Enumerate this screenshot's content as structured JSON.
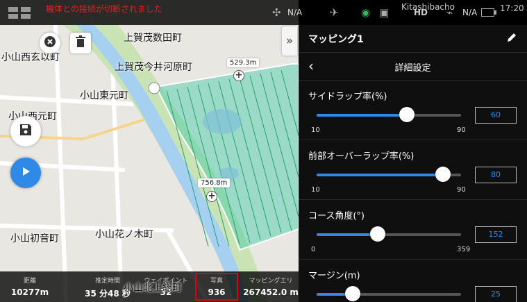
{
  "status_bar": {
    "warning": "機体との接続が切断されました",
    "signal_na": "N/A",
    "location": "Kitashibacho",
    "hd": "HD",
    "battery": "N/A",
    "time": "17:20",
    "top_map_text": "上賀茂数田町"
  },
  "map": {
    "labels": {
      "kamigamo": "上賀茂今井河原町",
      "koyama_nishi_genba": "小山西玄以町",
      "koyama_higashi_moto": "小山東元町",
      "koyama_nishi_moto": "小山西元町",
      "koyama_hatsune": "小山初音町",
      "koyama_hananoki": "小山花ノ木町",
      "koyama_kita_kamisou": "小山北上総町"
    },
    "distance_top": "529.3m",
    "distance_side": "756.8m"
  },
  "stats": [
    {
      "label": "距離",
      "value": "10277m"
    },
    {
      "label": "推定時間",
      "value": "35 分48 秒"
    },
    {
      "label": "ウェイポイント",
      "value": "32"
    },
    {
      "label": "写真",
      "value": "936"
    },
    {
      "label": "マッピングエリ",
      "value": "267452.0 m"
    }
  ],
  "panel": {
    "title": "マッピング1",
    "subtitle": "詳細設定",
    "settings": [
      {
        "label": "サイドラップ率(%)",
        "min": "10",
        "max": "90",
        "value": "60",
        "fraction": 0.625
      },
      {
        "label": "前部オーバーラップ率(%)",
        "min": "10",
        "max": "90",
        "value": "80",
        "fraction": 0.875
      },
      {
        "label": "コース角度(°)",
        "min": "0",
        "max": "359",
        "value": "152",
        "fraction": 0.423
      },
      {
        "label": "マージン(m)",
        "min": "",
        "max": "",
        "value": "25",
        "fraction": 0.25
      }
    ]
  },
  "colors": {
    "accent": "#2e8ae6",
    "play_button": "#2e8ae6",
    "mapping_area": "#3bc9a3",
    "highlight": "#e00000"
  },
  "icons": {
    "close": "close-icon",
    "delete": "trash-icon",
    "save": "save-icon",
    "play": "play-icon",
    "edit": "pencil-icon",
    "back": "back-icon",
    "collapse": "chevron-right-icon"
  }
}
